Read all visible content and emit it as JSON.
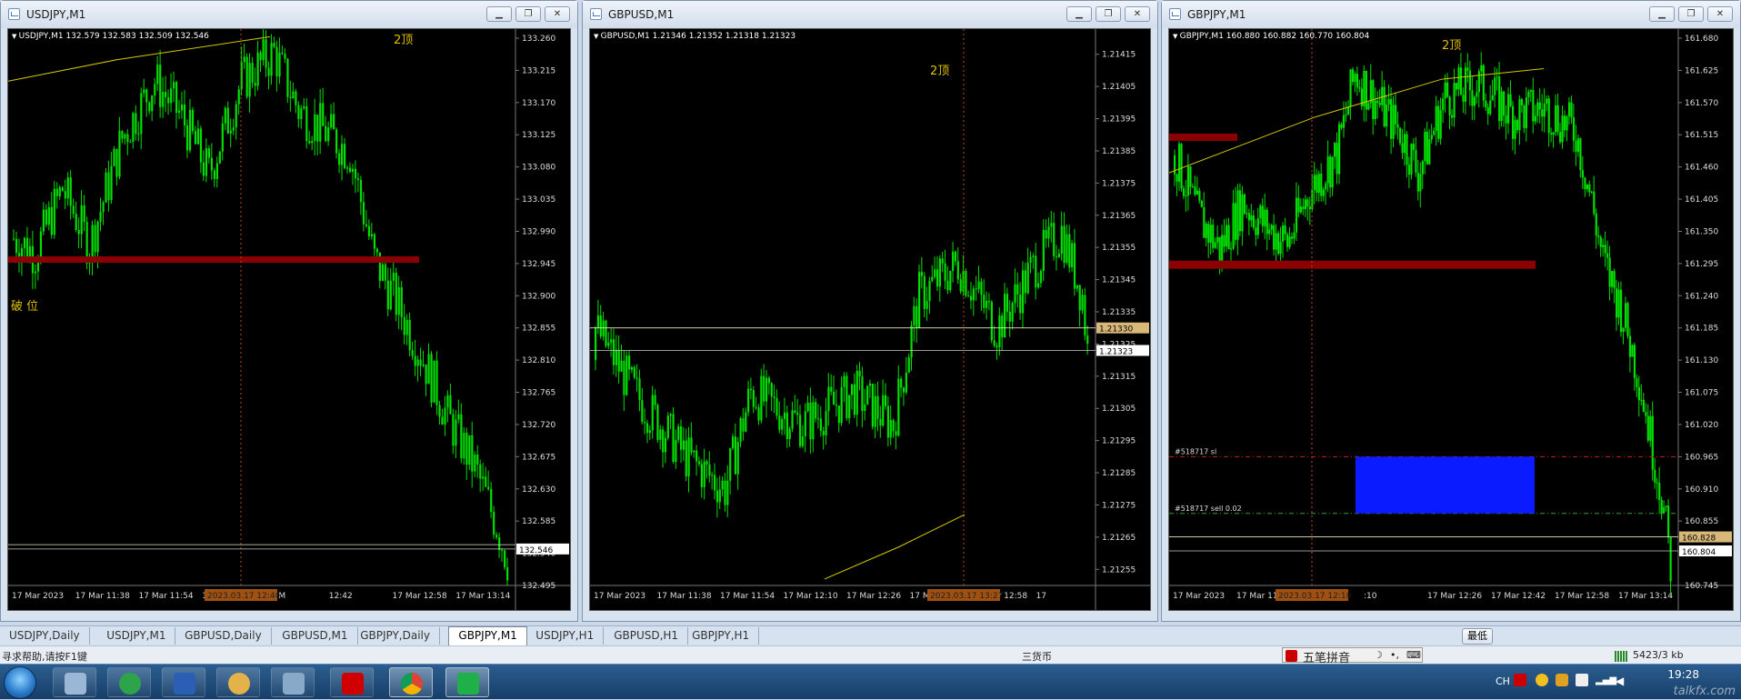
{
  "colors": {
    "candle": "#00e000",
    "level": "#8b0000",
    "ma": "#d4c800",
    "label": "#e0c000",
    "vline": "#b05010",
    "sl": "#c02020",
    "entry": "#30a030",
    "box": "#0a1cff"
  },
  "windows": [
    {
      "title": "USDJPY,M1",
      "header": "USDJPY,M1  132.579 132.583 132.509 132.546",
      "annotations": [
        {
          "text": "2顶"
        },
        {
          "text": "破 位"
        }
      ],
      "price_axis": {
        "min": 132.495,
        "max": 133.26,
        "ticks": [
          "133.260",
          "133.215",
          "133.170",
          "133.125",
          "133.080",
          "133.035",
          "132.990",
          "132.945",
          "132.900",
          "132.855",
          "132.810",
          "132.765",
          "132.720",
          "132.675",
          "132.630",
          "132.585",
          "132.540",
          "132.495"
        ],
        "current": "132.546"
      },
      "time_axis": [
        "17 Mar 2023",
        "17 Mar 11:38",
        "17 Mar 11:54",
        "17 Mar 12:10",
        "17 M",
        "12:42",
        "17 Mar 12:58",
        "17 Mar 13:14"
      ],
      "cursor_time": "2023.03.17 12:40",
      "series": {
        "start": 132.98,
        "keys": [
          [
            0,
            132.98
          ],
          [
            8,
            132.96
          ],
          [
            18,
            133.05
          ],
          [
            28,
            132.97
          ],
          [
            40,
            133.12
          ],
          [
            52,
            133.2
          ],
          [
            62,
            133.15
          ],
          [
            72,
            133.07
          ],
          [
            84,
            133.2
          ],
          [
            96,
            133.24
          ],
          [
            105,
            133.16
          ],
          [
            118,
            133.12
          ],
          [
            124,
            133.1
          ],
          [
            133,
            132.95
          ],
          [
            140,
            132.9
          ],
          [
            150,
            132.82
          ],
          [
            160,
            132.73
          ],
          [
            170,
            132.66
          ],
          [
            178,
            132.58
          ],
          [
            182,
            132.53
          ]
        ],
        "count": 183
      }
    },
    {
      "title": "GBPUSD,M1",
      "header": "GBPUSD,M1  1.21346 1.21352 1.21318 1.21323",
      "annotations": [
        {
          "text": "2顶"
        }
      ],
      "price_axis": {
        "min": 1.2125,
        "max": 1.2142,
        "ticks": [
          "1.21415",
          "1.21405",
          "1.21395",
          "1.21385",
          "1.21375",
          "1.21365",
          "1.21355",
          "1.21345",
          "1.21335",
          "1.21325",
          "1.21315",
          "1.21305",
          "1.21295",
          "1.21285",
          "1.21275",
          "1.21265",
          "1.21255"
        ],
        "current": "1.21323",
        "bid": "1.21330"
      },
      "time_axis": [
        "17 Mar 2023",
        "17 Mar 11:38",
        "17 Mar 11:54",
        "17 Mar 12:10",
        "17 Mar 12:26",
        "17 Mar 12:42",
        "17 Mar 12:58",
        "17"
      ],
      "cursor_time": "2023.03.17 13:27",
      "series": {
        "start": 1.2132,
        "keys": [
          [
            0,
            1.2133
          ],
          [
            15,
            1.2131
          ],
          [
            35,
            1.2129
          ],
          [
            50,
            1.2128
          ],
          [
            60,
            1.2131
          ],
          [
            80,
            1.213
          ],
          [
            100,
            1.2131
          ],
          [
            115,
            1.213
          ],
          [
            125,
            1.2134
          ],
          [
            140,
            1.2135
          ],
          [
            155,
            1.2133
          ],
          [
            170,
            1.2135
          ],
          [
            180,
            1.2136
          ],
          [
            188,
            1.2134
          ],
          [
            190,
            1.21323
          ]
        ],
        "count": 191
      }
    },
    {
      "title": "GBPJPY,M1",
      "header": "GBPJPY,M1  160.880 160.882 160.770 160.804",
      "annotations": [
        {
          "text": "2顶"
        }
      ],
      "price_axis": {
        "min": 160.745,
        "max": 161.68,
        "ticks": [
          "161.680",
          "161.625",
          "161.570",
          "161.515",
          "161.460",
          "161.405",
          "161.350",
          "161.295",
          "161.240",
          "161.185",
          "161.130",
          "161.075",
          "161.020",
          "160.965",
          "160.910",
          "160.855",
          "160.800",
          "160.745"
        ],
        "current": "160.804",
        "bid": "160.828"
      },
      "time_axis": [
        "17 Mar 2023",
        "17 Mar 11:38",
        "17 Ma",
        ":10",
        "17 Mar 12:26",
        "17 Mar 12:42",
        "17 Mar 12:58",
        "17 Mar 13:14"
      ],
      "cursor_time": "2023.03.17 12:10",
      "order_labels": [
        "#518717 sl",
        "#518717 sell 0.02"
      ],
      "series": {
        "start": 161.48,
        "keys": [
          [
            0,
            161.48
          ],
          [
            10,
            161.38
          ],
          [
            20,
            161.32
          ],
          [
            30,
            161.4
          ],
          [
            40,
            161.36
          ],
          [
            50,
            161.33
          ],
          [
            60,
            161.42
          ],
          [
            72,
            161.48
          ],
          [
            80,
            161.62
          ],
          [
            88,
            161.58
          ],
          [
            100,
            161.52
          ],
          [
            108,
            161.45
          ],
          [
            120,
            161.58
          ],
          [
            135,
            161.6
          ],
          [
            150,
            161.55
          ],
          [
            165,
            161.56
          ],
          [
            178,
            161.52
          ],
          [
            185,
            161.4
          ],
          [
            190,
            161.3
          ],
          [
            198,
            161.22
          ],
          [
            206,
            161.1
          ],
          [
            212,
            160.98
          ],
          [
            216,
            160.9
          ],
          [
            220,
            160.78
          ]
        ],
        "count": 221
      }
    }
  ],
  "tabs": [
    "USDJPY,Daily",
    "USDJPY,M1",
    "GBPUSD,Daily",
    "GBPUSD,M1",
    "GBPJPY,Daily",
    "GBPJPY,M1",
    "USDJPY,H1",
    "GBPUSD,H1",
    "GBPJPY,H1"
  ],
  "active_tab": "GBPJPY,M1",
  "lowest_btn": "最低",
  "status": {
    "help": "寻求帮助,请按F1键",
    "center": "三货币",
    "ime": "五笔拼音",
    "traffic": "5423/3 kb"
  },
  "taskbar": {
    "clock": "19:28",
    "lang": "CH",
    "watermark": "talkfx.com",
    "apps": [
      "calculator",
      "metatrader",
      "word",
      "paint",
      "network",
      "fxpro",
      "chrome",
      "signal"
    ]
  }
}
